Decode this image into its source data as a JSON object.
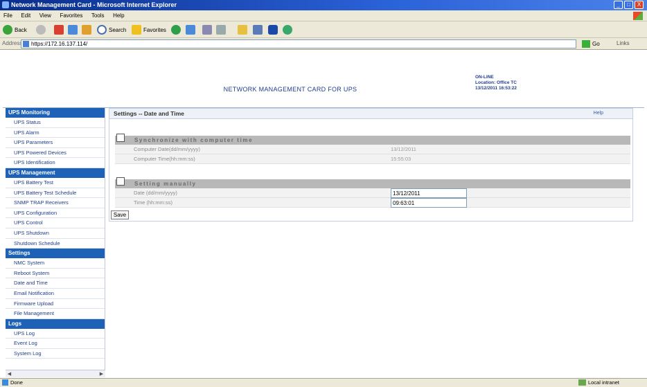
{
  "window": {
    "title": "Network Management Card - Microsoft Internet Explorer",
    "minimize": "_",
    "maximize": "□",
    "close": "X"
  },
  "menu": [
    "File",
    "Edit",
    "View",
    "Favorites",
    "Tools",
    "Help"
  ],
  "toolbar": {
    "back": "Back",
    "search": "Search",
    "favorites": "Favorites"
  },
  "address": {
    "label": "Address",
    "url": "https://172.16.137.114/",
    "go": "Go",
    "links": "Links"
  },
  "header": {
    "title": "NETWORK MANAGEMENT CARD FOR UPS",
    "status": "ON-LINE",
    "location": "Location: Office TC",
    "datetime": "13/12/2011 16:53:22"
  },
  "sidebar": {
    "sections": [
      {
        "label": "UPS Monitoring",
        "items": [
          "UPS Status",
          "UPS Alarm",
          "UPS Parameters",
          "UPS Powered Devices",
          "UPS Identification"
        ]
      },
      {
        "label": "UPS Management",
        "items": [
          "UPS Battery Test",
          "UPS Battery Test Schedule",
          "SNMP TRAP Receivers",
          "UPS Configuration",
          "UPS Control",
          "UPS Shutdown",
          "Shutdown Schedule"
        ]
      },
      {
        "label": "Settings",
        "items": [
          "NMC System",
          "Reboot System",
          "Date and Time",
          "Email Notification",
          "Firmware Upload",
          "File Management"
        ]
      },
      {
        "label": "Logs",
        "items": [
          "UPS Log",
          "Event Log",
          "System Log"
        ]
      }
    ]
  },
  "main": {
    "title": "Settings -- Date and Time",
    "help": "Help",
    "sync": {
      "heading": "Synchronize with computer time",
      "date_label": "Computer Date(dd/mm/yyyy)",
      "date_value": "13/12/2011",
      "time_label": "Computer Time(hh:mm:ss)",
      "time_value": "15:55:03"
    },
    "manual": {
      "heading": "Setting manually",
      "date_label": "Date (dd/mm/yyyy)",
      "date_value": "13/12/2011",
      "time_label": "Time (hh:mm:ss)",
      "time_value": "09:63:01"
    },
    "save": "Save"
  },
  "status": {
    "left": "Done",
    "right": "Local intranet"
  }
}
